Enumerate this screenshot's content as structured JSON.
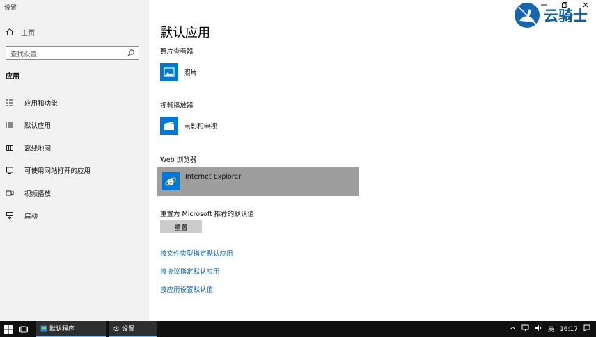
{
  "window": {
    "title": "设置",
    "watermark_text": "云骑士"
  },
  "sidebar": {
    "home": "主页",
    "search_placeholder": "查找设置",
    "section": "应用",
    "items": [
      {
        "label": "应用和功能",
        "icon": "list-icon"
      },
      {
        "label": "默认应用",
        "icon": "default-apps-icon"
      },
      {
        "label": "离线地图",
        "icon": "map-icon"
      },
      {
        "label": "可使用网站打开的应用",
        "icon": "website-app-icon"
      },
      {
        "label": "视频播放",
        "icon": "video-icon"
      },
      {
        "label": "启动",
        "icon": "startup-icon"
      }
    ]
  },
  "main": {
    "title": "默认应用",
    "photo_viewer": {
      "label": "照片查看器",
      "app": "照片"
    },
    "video_player": {
      "label": "视频播放器",
      "app": "电影和电视"
    },
    "web_browser": {
      "label": "Web 浏览器",
      "app": "Internet Explorer"
    },
    "reset": {
      "label": "重置为 Microsoft 推荐的默认值",
      "button": "重置"
    },
    "links": [
      "按文件类型指定默认应用",
      "按协议指定默认应用",
      "按应用设置默认值"
    ]
  },
  "taskbar": {
    "apps": [
      "默认程序",
      "设置"
    ],
    "ime": "英",
    "time": "16:17"
  },
  "colors": {
    "accent": "#0078d7",
    "link": "#0063b1",
    "highlight": "#9e9e9e",
    "taskbar": "#101010"
  }
}
